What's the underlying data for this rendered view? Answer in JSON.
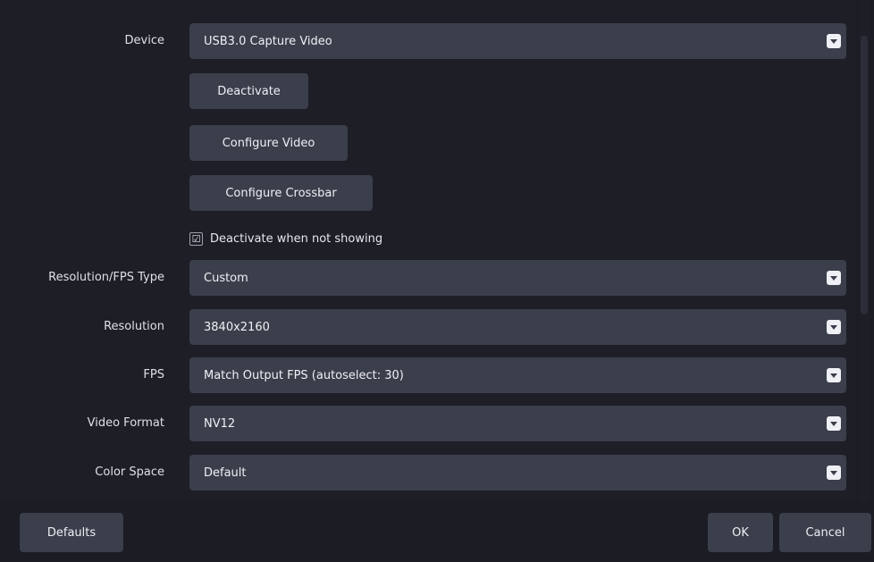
{
  "form": {
    "device": {
      "label": "Device",
      "value": "USB3.0 Capture Video"
    },
    "buttons": {
      "deactivate": "Deactivate",
      "configure_video": "Configure Video",
      "configure_crossbar": "Configure Crossbar"
    },
    "deactivate_when_not_showing": {
      "label": "Deactivate when not showing",
      "checked": true,
      "mark": "☑"
    },
    "resolution_fps_type": {
      "label": "Resolution/FPS Type",
      "value": "Custom"
    },
    "resolution": {
      "label": "Resolution",
      "value": "3840x2160"
    },
    "fps": {
      "label": "FPS",
      "value": "Match Output FPS (autoselect: 30)"
    },
    "video_format": {
      "label": "Video Format",
      "value": "NV12"
    },
    "color_space": {
      "label": "Color Space",
      "value": "Default"
    }
  },
  "footer": {
    "defaults": "Defaults",
    "ok": "OK",
    "cancel": "Cancel"
  },
  "colors": {
    "background": "#1b1c24",
    "control": "#3b3e4b",
    "text": "#e7e8ee"
  },
  "icons": {
    "dropdown": "chevron-down-icon",
    "checkbox": "check-icon"
  }
}
